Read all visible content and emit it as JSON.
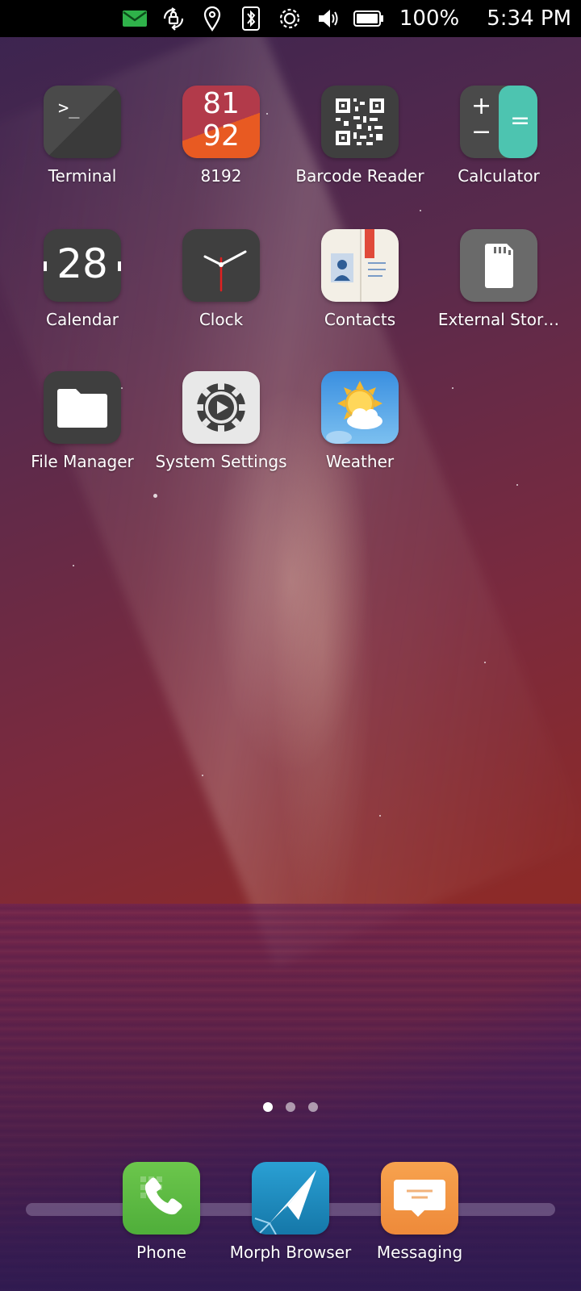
{
  "status_bar": {
    "icons": [
      "mail-icon",
      "rotation-lock-icon",
      "location-icon",
      "bluetooth-icon",
      "brightness-icon",
      "volume-icon",
      "battery-icon"
    ],
    "battery": "100%",
    "time": "5:34 PM"
  },
  "apps": [
    {
      "name": "terminal",
      "label": "Terminal",
      "glyph": ">_"
    },
    {
      "name": "8192",
      "label": "8192",
      "top": "81",
      "bottom": "92"
    },
    {
      "name": "barcode-reader",
      "label": "Barcode Reader"
    },
    {
      "name": "calculator",
      "label": "Calculator",
      "plus": "+",
      "minus": "−",
      "equals": "="
    },
    {
      "name": "calendar",
      "label": "Calendar",
      "day": "28"
    },
    {
      "name": "clock",
      "label": "Clock"
    },
    {
      "name": "contacts",
      "label": "Contacts"
    },
    {
      "name": "external-storage",
      "label": "External Stor…"
    },
    {
      "name": "file-manager",
      "label": "File Manager"
    },
    {
      "name": "system-settings",
      "label": "System Settings"
    },
    {
      "name": "weather",
      "label": "Weather"
    }
  ],
  "dock": [
    {
      "name": "phone",
      "label": "Phone"
    },
    {
      "name": "morph-browser",
      "label": "Morph Browser"
    },
    {
      "name": "messaging",
      "label": "Messaging"
    }
  ],
  "pages": {
    "count": 3,
    "active": 1
  },
  "colors": {
    "mail": "#2fb24a",
    "phone": "#5ec04a",
    "browser": "#1f8fc2",
    "messaging": "#f2994a",
    "calculator_accent": "#4dc4b0",
    "counter_top": "#b23a4a",
    "counter_bottom": "#e85a22"
  }
}
